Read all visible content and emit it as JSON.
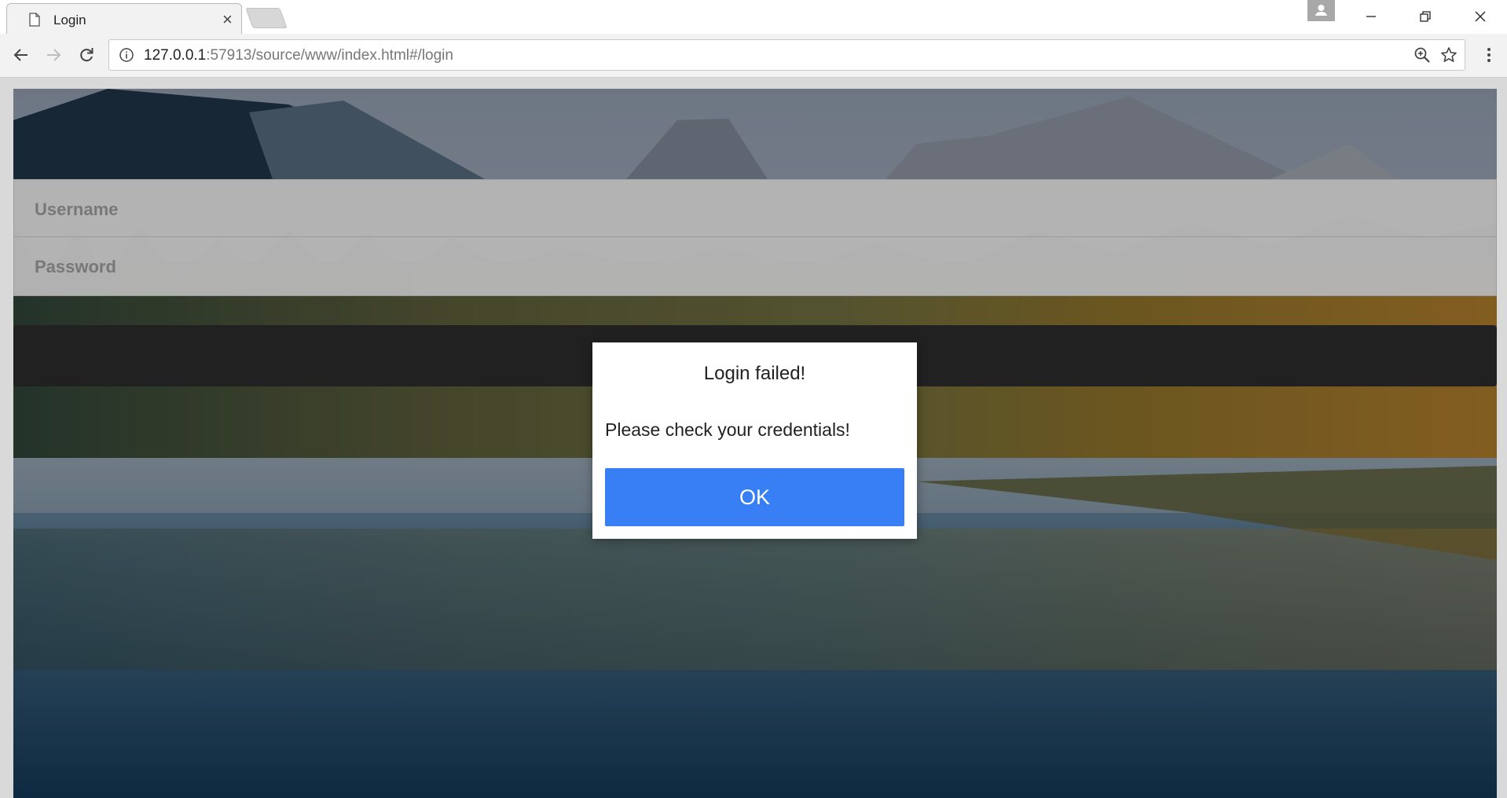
{
  "browser": {
    "tab": {
      "title": "Login"
    },
    "address_bar": {
      "host": "127.0.0.1",
      "rest": ":57913/source/www/index.html#/login"
    }
  },
  "page": {
    "form": {
      "username_label": "Username",
      "password_label": "Password"
    },
    "login_button": "Login"
  },
  "dialog": {
    "title": "Login failed!",
    "message": "Please check your credentials!",
    "ok_label": "OK"
  },
  "colors": {
    "ok_button": "#387ef5",
    "login_button": "#2b2b2b"
  },
  "icons": [
    "page-icon",
    "close-icon",
    "profile-icon",
    "minimize-icon",
    "restore-icon",
    "window-close-icon",
    "back-icon",
    "forward-icon",
    "reload-icon",
    "info-icon",
    "zoom-icon",
    "star-icon",
    "menu-icon"
  ]
}
